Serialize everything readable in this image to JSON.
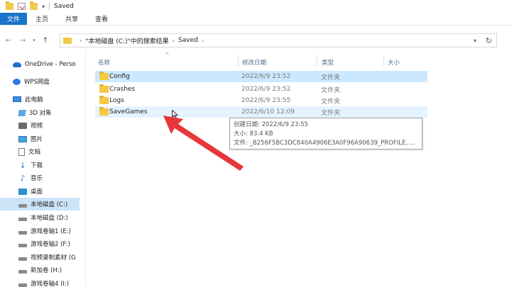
{
  "window": {
    "title": "Saved",
    "quick_access": [
      "folder-icon",
      "properties-icon",
      "folder-icon",
      "pin-down-icon"
    ]
  },
  "ribbon": {
    "tabs": [
      {
        "label": "文件",
        "active": true
      },
      {
        "label": "主页",
        "active": false
      },
      {
        "label": "共享",
        "active": false
      },
      {
        "label": "查看",
        "active": false
      }
    ]
  },
  "address": {
    "crumbs": [
      "\"本地磁盘 (C:)\"中的搜索结果",
      "Saved"
    ]
  },
  "nav_pane": {
    "items": [
      {
        "label": "OneDrive - Perso",
        "icon": "cloud-icon"
      },
      {
        "label": "WPS网盘",
        "icon": "wps-cloud-icon"
      },
      {
        "label": "此电脑",
        "icon": "computer-icon"
      },
      {
        "label": "3D 对象",
        "icon": "cube-icon"
      },
      {
        "label": "视频",
        "icon": "video-icon"
      },
      {
        "label": "图片",
        "icon": "pictures-icon"
      },
      {
        "label": "文档",
        "icon": "documents-icon"
      },
      {
        "label": "下载",
        "icon": "download-icon"
      },
      {
        "label": "音乐",
        "icon": "music-icon"
      },
      {
        "label": "桌面",
        "icon": "desktop-icon"
      },
      {
        "label": "本地磁盘 (C:)",
        "icon": "drive-icon",
        "selected": true
      },
      {
        "label": "本地磁盘 (D:)",
        "icon": "drive-icon"
      },
      {
        "label": "游戏卷轴1 (E:)",
        "icon": "drive-icon"
      },
      {
        "label": "游戏卷轴2 (F:)",
        "icon": "drive-icon"
      },
      {
        "label": "视频录制素材 (G",
        "icon": "drive-icon"
      },
      {
        "label": "新加卷 (H:)",
        "icon": "drive-icon"
      },
      {
        "label": "游戏卷轴4 (I:)",
        "icon": "drive-icon"
      }
    ]
  },
  "columns": {
    "name": "名称",
    "date": "修改日期",
    "type": "类型",
    "size": "大小"
  },
  "files": [
    {
      "name": "Config",
      "date": "2022/6/9 23:52",
      "type": "文件夹",
      "state": "selected"
    },
    {
      "name": "Crashes",
      "date": "2022/6/9 23:52",
      "type": "文件夹",
      "state": "normal"
    },
    {
      "name": "Logs",
      "date": "2022/6/9 23:55",
      "type": "文件夹",
      "state": "normal"
    },
    {
      "name": "SaveGames",
      "date": "2022/6/10 12:09",
      "type": "文件夹",
      "state": "hover"
    }
  ],
  "tooltip": {
    "created": "创建日期: 2022/6/9 23:55",
    "size": "大小: 83.4 KB",
    "files": "文件: _B256F5BC3DC840A4906E3A0F96A90639_PROFILE, ..."
  },
  "colors": {
    "accent": "#1a73c8",
    "selection": "#cce8ff",
    "hover": "#e5f3ff",
    "folder": "#f5c842",
    "annotation_arrow": "#e8363a"
  }
}
